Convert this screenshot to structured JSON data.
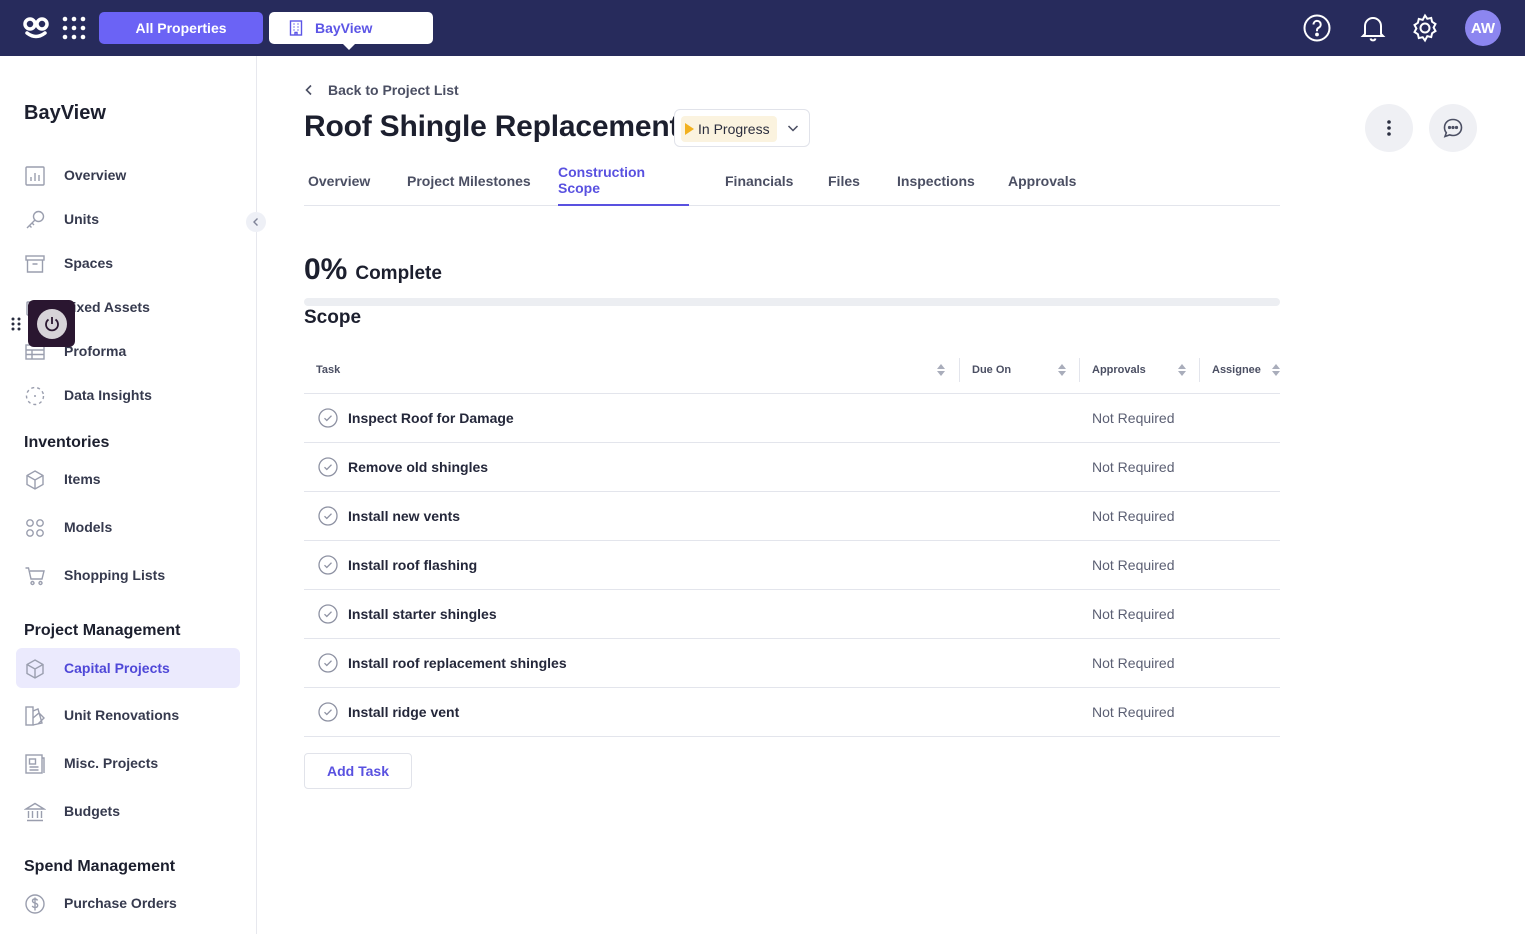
{
  "topbar": {
    "all_properties": "All Properties",
    "property": "BayView",
    "avatar_initials": "AW",
    "bg_color": "#272b5c",
    "accent": "#6b63f5"
  },
  "sidebar": {
    "title": "BayView",
    "items": [
      {
        "label": "Overview",
        "icon": "bar-chart-icon"
      },
      {
        "label": "Units",
        "icon": "key-icon"
      },
      {
        "label": "Spaces",
        "icon": "archive-icon"
      },
      {
        "label": "Fixed Assets",
        "icon": "asset-icon"
      },
      {
        "label": "Proforma",
        "icon": "table-icon"
      },
      {
        "label": "Data Insights",
        "icon": "insights-icon"
      }
    ],
    "inventories_heading": "Inventories",
    "inventories": [
      {
        "label": "Items",
        "icon": "box-icon"
      },
      {
        "label": "Models",
        "icon": "grid-icon"
      },
      {
        "label": "Shopping Lists",
        "icon": "cart-icon"
      }
    ],
    "project_heading": "Project Management",
    "projects": [
      {
        "label": "Capital Projects",
        "icon": "box-icon",
        "active": true
      },
      {
        "label": "Unit Renovations",
        "icon": "paint-icon"
      },
      {
        "label": "Misc. Projects",
        "icon": "document-icon"
      },
      {
        "label": "Budgets",
        "icon": "bank-icon"
      }
    ],
    "spend_heading": "Spend Management",
    "spend": [
      {
        "label": "Purchase Orders",
        "icon": "dollar-icon"
      }
    ]
  },
  "main": {
    "back_label": "Back to Project List",
    "title": "Roof Shingle Replacement",
    "status": "In Progress",
    "tabs": [
      {
        "label": "Overview"
      },
      {
        "label": "Project Milestones"
      },
      {
        "label": "Construction Scope",
        "active": true
      },
      {
        "label": "Financials"
      },
      {
        "label": "Files"
      },
      {
        "label": "Inspections"
      },
      {
        "label": "Approvals"
      }
    ],
    "percent": "0%",
    "percent_label": "Complete",
    "progress_value": 0,
    "scope_heading": "Scope",
    "columns": [
      "Task",
      "Due On",
      "Approvals",
      "Assignee"
    ],
    "rows": [
      {
        "task": "Inspect Roof for Damage",
        "due": "",
        "approvals": "Not Required",
        "assignee": ""
      },
      {
        "task": "Remove old shingles",
        "due": "",
        "approvals": "Not Required",
        "assignee": ""
      },
      {
        "task": "Install new vents",
        "due": "",
        "approvals": "Not Required",
        "assignee": ""
      },
      {
        "task": "Install roof flashing",
        "due": "",
        "approvals": "Not Required",
        "assignee": ""
      },
      {
        "task": "Install starter shingles",
        "due": "",
        "approvals": "Not Required",
        "assignee": ""
      },
      {
        "task": "Install roof replacement shingles",
        "due": "",
        "approvals": "Not Required",
        "assignee": ""
      },
      {
        "task": "Install ridge vent",
        "due": "",
        "approvals": "Not Required",
        "assignee": ""
      }
    ],
    "add_task_label": "Add Task"
  }
}
